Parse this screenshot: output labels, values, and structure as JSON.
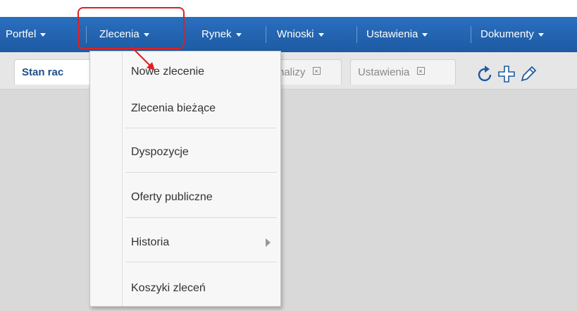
{
  "nav": {
    "items": [
      {
        "label": "Portfel"
      },
      {
        "label": "Zlecenia"
      },
      {
        "label": "Rynek"
      },
      {
        "label": "Wnioski"
      },
      {
        "label": "Ustawienia"
      },
      {
        "label": "Dokumenty"
      }
    ]
  },
  "tabs": {
    "active_label": "Stan rac",
    "analizy_label": "nalizy",
    "ustawienia_label": "Ustawienia"
  },
  "toolbar": {
    "icons": [
      "refresh-icon",
      "move-icon",
      "pencil-icon"
    ]
  },
  "menu": {
    "items": [
      {
        "label": "Nowe zlecenie"
      },
      {
        "label": "Zlecenia bieżące"
      },
      {
        "label": "Dyspozycje"
      },
      {
        "label": "Oferty publiczne"
      },
      {
        "label": "Historia"
      },
      {
        "label": "Koszyki zleceń"
      }
    ]
  },
  "colors": {
    "navbar": "#1d5aa3",
    "highlight": "#e02020",
    "active_tab_text": "#1f4e8c"
  }
}
